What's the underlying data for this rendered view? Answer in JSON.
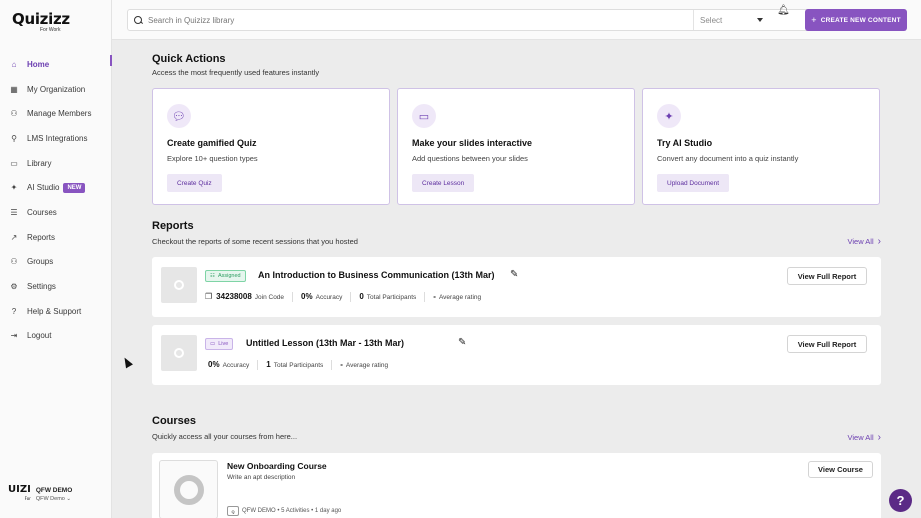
{
  "brand": {
    "logo": "Quizizz",
    "logo_sub": "For Work",
    "accent": "#8854c0"
  },
  "sidebar": {
    "items": [
      {
        "label": "Home",
        "icon": "home-icon",
        "active": true
      },
      {
        "label": "My Organization",
        "icon": "organization-icon"
      },
      {
        "label": "Manage Members",
        "icon": "members-icon"
      },
      {
        "label": "LMS Integrations",
        "icon": "lms-icon"
      },
      {
        "label": "Library",
        "icon": "library-icon"
      },
      {
        "label": "AI Studio",
        "icon": "sparkle-icon",
        "badge": "NEW"
      },
      {
        "label": "Courses",
        "icon": "courses-icon"
      },
      {
        "label": "Reports",
        "icon": "reports-icon"
      },
      {
        "label": "Groups",
        "icon": "groups-icon"
      },
      {
        "label": "Settings",
        "icon": "gear-icon"
      },
      {
        "label": "Help & Support",
        "icon": "question-icon"
      },
      {
        "label": "Logout",
        "icon": "logout-icon"
      }
    ],
    "org": {
      "logo": "UIZI",
      "logo_sub": "For",
      "name": "QFW DEMO",
      "sub": "QFW Demo"
    }
  },
  "topbar": {
    "search_placeholder": "Search in Quizizz library",
    "select_label": "Select",
    "create_label": "CREATE NEW CONTENT"
  },
  "quick_actions": {
    "title": "Quick Actions",
    "subtitle": "Access the most frequently used features instantly",
    "cards": [
      {
        "title": "Create gamified Quiz",
        "desc": "Explore 10+ question types",
        "button": "Create Quiz",
        "icon": "chat-bubbles-icon"
      },
      {
        "title": "Make your slides interactive",
        "desc": "Add questions between your slides",
        "button": "Create Lesson",
        "icon": "presentation-icon"
      },
      {
        "title": "Try AI Studio",
        "desc": "Convert any document into a quiz instantly",
        "button": "Upload Document",
        "icon": "sparkle-icon"
      }
    ]
  },
  "reports": {
    "title": "Reports",
    "subtitle": "Checkout the reports of some recent sessions that you hosted",
    "view_all": "View All",
    "items": [
      {
        "tag": "Assigned",
        "title": "An Introduction to Business Communication (13th Mar)",
        "code": "34238008",
        "code_label": "Join Code",
        "accuracy": "0%",
        "accuracy_label": "Accuracy",
        "participants": "0",
        "participants_label": "Total Participants",
        "rating": "-",
        "rating_label": "Average rating",
        "button": "View Full Report"
      },
      {
        "tag": "Live",
        "title": "Untitled Lesson (13th Mar - 13th Mar)",
        "accuracy": "0%",
        "accuracy_label": "Accuracy",
        "participants": "1",
        "participants_label": "Total Participants",
        "rating": "-",
        "rating_label": "Average rating",
        "button": "View Full Report"
      }
    ]
  },
  "courses": {
    "title": "Courses",
    "subtitle": "Quickly access all your courses from here...",
    "view_all": "View All",
    "items": [
      {
        "title": "New Onboarding Course",
        "desc": "Write an apt description",
        "meta_org": "QFW DEMO",
        "meta_activities": "5 Activities",
        "meta_time": "1 day ago",
        "button": "View Course"
      }
    ]
  },
  "help_label": "?"
}
